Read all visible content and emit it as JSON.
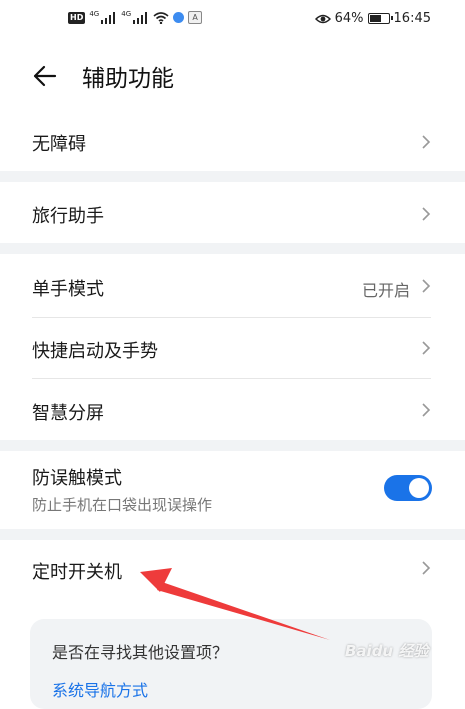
{
  "status_bar": {
    "hd_label": "HD",
    "net1": "4G",
    "net2": "4G",
    "ime_label": "A",
    "battery": "64%",
    "battery_level": 0.64,
    "time": "16:45"
  },
  "header": {
    "back_icon": "arrow-left-icon",
    "title": "辅助功能"
  },
  "items": [
    {
      "label": "无障碍"
    },
    {
      "label": "旅行助手"
    },
    {
      "label": "单手模式",
      "value": "已开启"
    },
    {
      "label": "快捷启动及手势"
    },
    {
      "label": "智慧分屏"
    },
    {
      "label": "防误触模式",
      "subtitle": "防止手机在口袋出现误操作",
      "toggle_on": true
    },
    {
      "label": "定时开关机"
    }
  ],
  "suggestion": {
    "question": "是否在寻找其他设置项？",
    "link": "系统导航方式"
  },
  "watermark": "Baidu 经验",
  "colors": {
    "accent": "#1a73e8",
    "annotation_arrow": "#ee3b3b",
    "section_gap": "#f1f3f5"
  }
}
